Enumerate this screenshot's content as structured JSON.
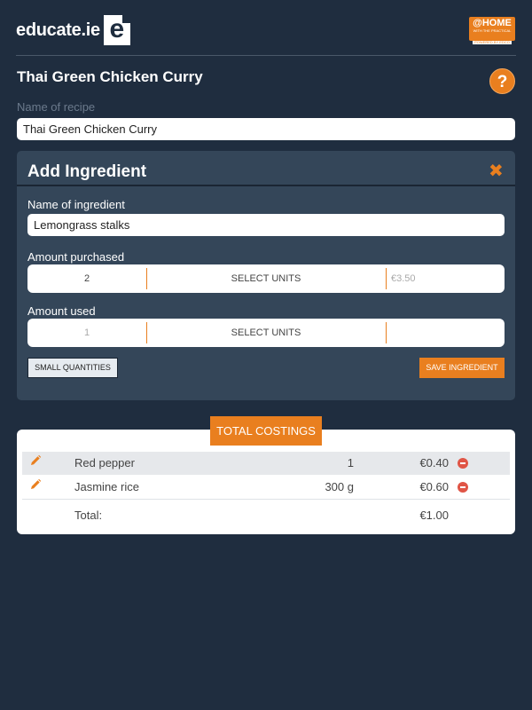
{
  "header": {
    "logo_text": "educate.ie",
    "logo_mark": "e",
    "badge_main": "@HOME",
    "badge_sub": "WITH THE PRACTICAL",
    "badge_tiny": "POWERED BY EDCO",
    "accent_color": "#e97f1f"
  },
  "recipe": {
    "page_title": "Thai Green Chicken Curry",
    "help_label": "?",
    "name_label": "Name of recipe",
    "name_value": "Thai Green Chicken Curry"
  },
  "add_ingredient": {
    "title": "Add Ingredient",
    "close_icon": "close-icon",
    "name_label": "Name of ingredient",
    "name_value": "Lemongrass stalks",
    "purchased_label": "Amount purchased",
    "purchased_qty": "2",
    "purchased_units": "SELECT UNITS",
    "purchased_price": "€3.50",
    "used_label": "Amount used",
    "used_qty": "1",
    "used_units": "SELECT UNITS",
    "small_quantities_label": "SMALL QUANTITIES",
    "save_label": "SAVE INGREDIENT"
  },
  "costings": {
    "header": "TOTAL COSTINGS",
    "rows": [
      {
        "name": "Red pepper",
        "qty": "1",
        "price": "€0.40"
      },
      {
        "name": "Jasmine rice",
        "qty": "300 g",
        "price": "€0.60"
      }
    ],
    "total_label": "Total:",
    "total_value": "€1.00"
  }
}
